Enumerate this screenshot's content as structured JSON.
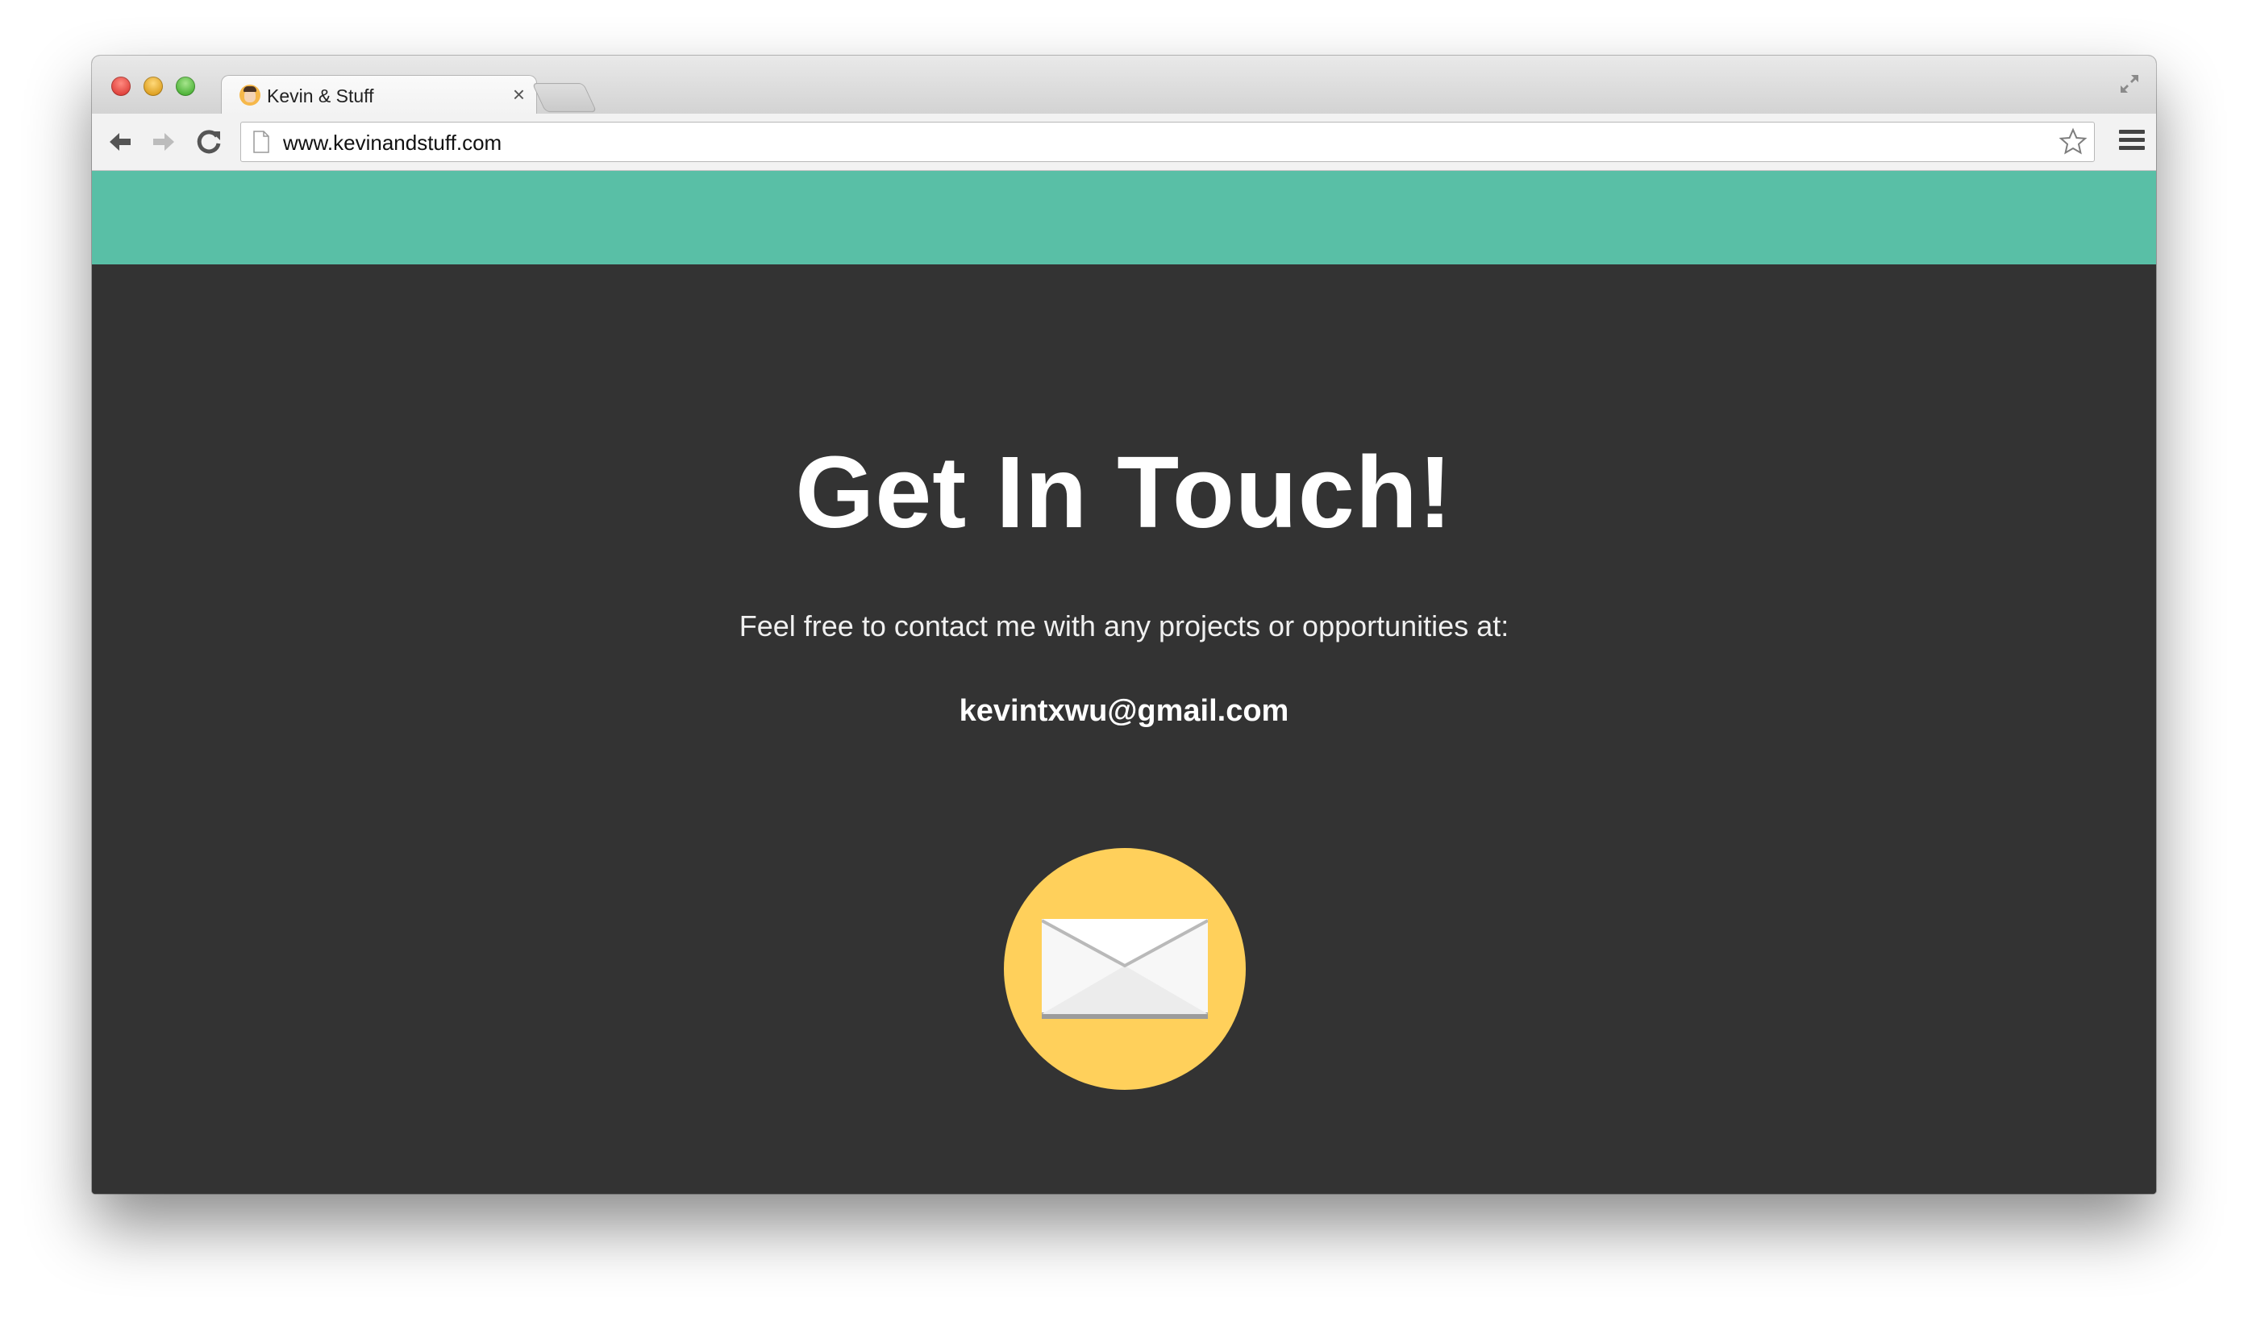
{
  "browser": {
    "tab": {
      "title": "Kevin & Stuff",
      "close_glyph": "×",
      "favicon": "avatar-favicon"
    },
    "address_bar": {
      "url": "www.kevinandstuff.com"
    },
    "icons": {
      "back": "back-arrow-icon",
      "forward": "forward-arrow-icon",
      "reload": "reload-icon",
      "bookmark": "star-icon",
      "menu": "hamburger-menu-icon",
      "fullscreen": "fullscreen-icon"
    }
  },
  "page": {
    "headline": "Get In Touch!",
    "subtitle": "Feel free to contact me with any projects or opportunities at:",
    "email": "kevintxwu@gmail.com",
    "mail_button_icon": "envelope-icon"
  },
  "colors": {
    "header_band": "#59bfa6",
    "background": "#333333",
    "mail_circle": "#ffd05b",
    "text": "#ffffff"
  }
}
